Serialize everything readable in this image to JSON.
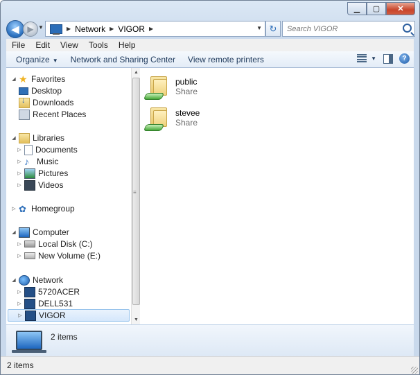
{
  "address": {
    "crumbs": [
      "Network",
      "VIGOR"
    ]
  },
  "search": {
    "placeholder": "Search VIGOR"
  },
  "menu": {
    "items": [
      "File",
      "Edit",
      "View",
      "Tools",
      "Help"
    ]
  },
  "commands": {
    "organize": "Organize",
    "network_center": "Network and Sharing Center",
    "remote_printers": "View remote printers"
  },
  "nav": {
    "favorites": {
      "label": "Favorites",
      "items": [
        "Desktop",
        "Downloads",
        "Recent Places"
      ]
    },
    "libraries": {
      "label": "Libraries",
      "items": [
        "Documents",
        "Music",
        "Pictures",
        "Videos"
      ]
    },
    "homegroup": {
      "label": "Homegroup"
    },
    "computer": {
      "label": "Computer",
      "items": [
        "Local Disk (C:)",
        "New Volume (E:)"
      ]
    },
    "network": {
      "label": "Network",
      "items": [
        "5720ACER",
        "DELL531",
        "VIGOR"
      ],
      "selected": "VIGOR"
    }
  },
  "files": [
    {
      "name": "public",
      "type": "Share"
    },
    {
      "name": "stevee",
      "type": "Share"
    }
  ],
  "details": {
    "text": "2 items"
  },
  "status": {
    "text": "2 items"
  }
}
